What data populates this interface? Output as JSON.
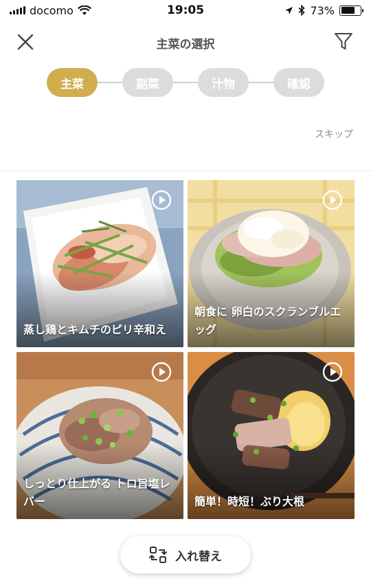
{
  "status": {
    "carrier": "docomo",
    "time": "19:05",
    "battery": "73%",
    "battery_level": 0.73
  },
  "header": {
    "title": "主菜の選択",
    "close_icon": "close-icon",
    "filter_icon": "filter-icon"
  },
  "steps": [
    {
      "label": "主菜",
      "active": true
    },
    {
      "label": "副菜",
      "active": false
    },
    {
      "label": "汁物",
      "active": false
    },
    {
      "label": "確認",
      "active": false
    }
  ],
  "skip_label": "スキップ",
  "recipes": [
    {
      "title": "蒸し鶏とキムチのピリ辛和え",
      "icon": "play-icon"
    },
    {
      "title": "朝食に 卵白のスクランブルエッグ",
      "icon": "play-icon"
    },
    {
      "title": "しっとり仕上がる トロ旨塩レバー",
      "icon": "play-icon"
    },
    {
      "title": "簡単！時短！ぶり大根",
      "icon": "play-icon"
    }
  ],
  "swap_button": {
    "label": "入れ替え",
    "icon": "swap-icon"
  },
  "colors": {
    "accent": "#d2ad4f",
    "inactive_step": "#dcdcdc",
    "skip_text": "#8c8c8c"
  }
}
